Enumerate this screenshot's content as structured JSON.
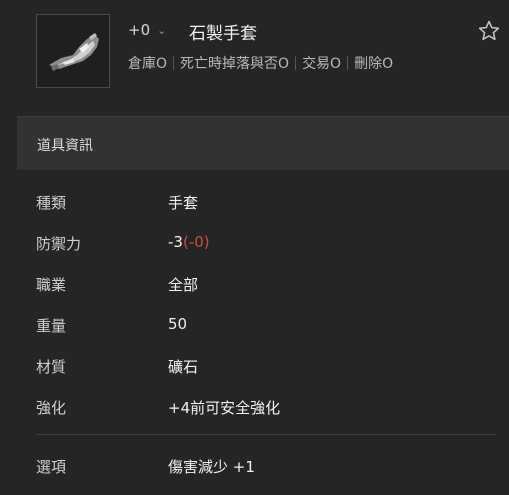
{
  "item": {
    "icon": "stone-gloves-icon",
    "enhance_level": "+0",
    "name": "石製手套",
    "flags": [
      "倉庫O",
      "死亡時掉落與否O",
      "交易O",
      "刪除O"
    ]
  },
  "section": {
    "title": "道具資訊"
  },
  "details": {
    "type": {
      "label": "種類",
      "value": "手套"
    },
    "defense": {
      "label": "防禦力",
      "value": "-3",
      "extra": "(-0)"
    },
    "class": {
      "label": "職業",
      "value": "全部"
    },
    "weight": {
      "label": "重量",
      "value": "50"
    },
    "material": {
      "label": "材質",
      "value": "礦石"
    },
    "enchant": {
      "label": "強化",
      "value": "+4前可安全強化"
    }
  },
  "option": {
    "label": "選項",
    "value": "傷害減少 +1"
  },
  "colors": {
    "background": "#252525",
    "section": "#323232",
    "penalty": "#c9503c"
  }
}
